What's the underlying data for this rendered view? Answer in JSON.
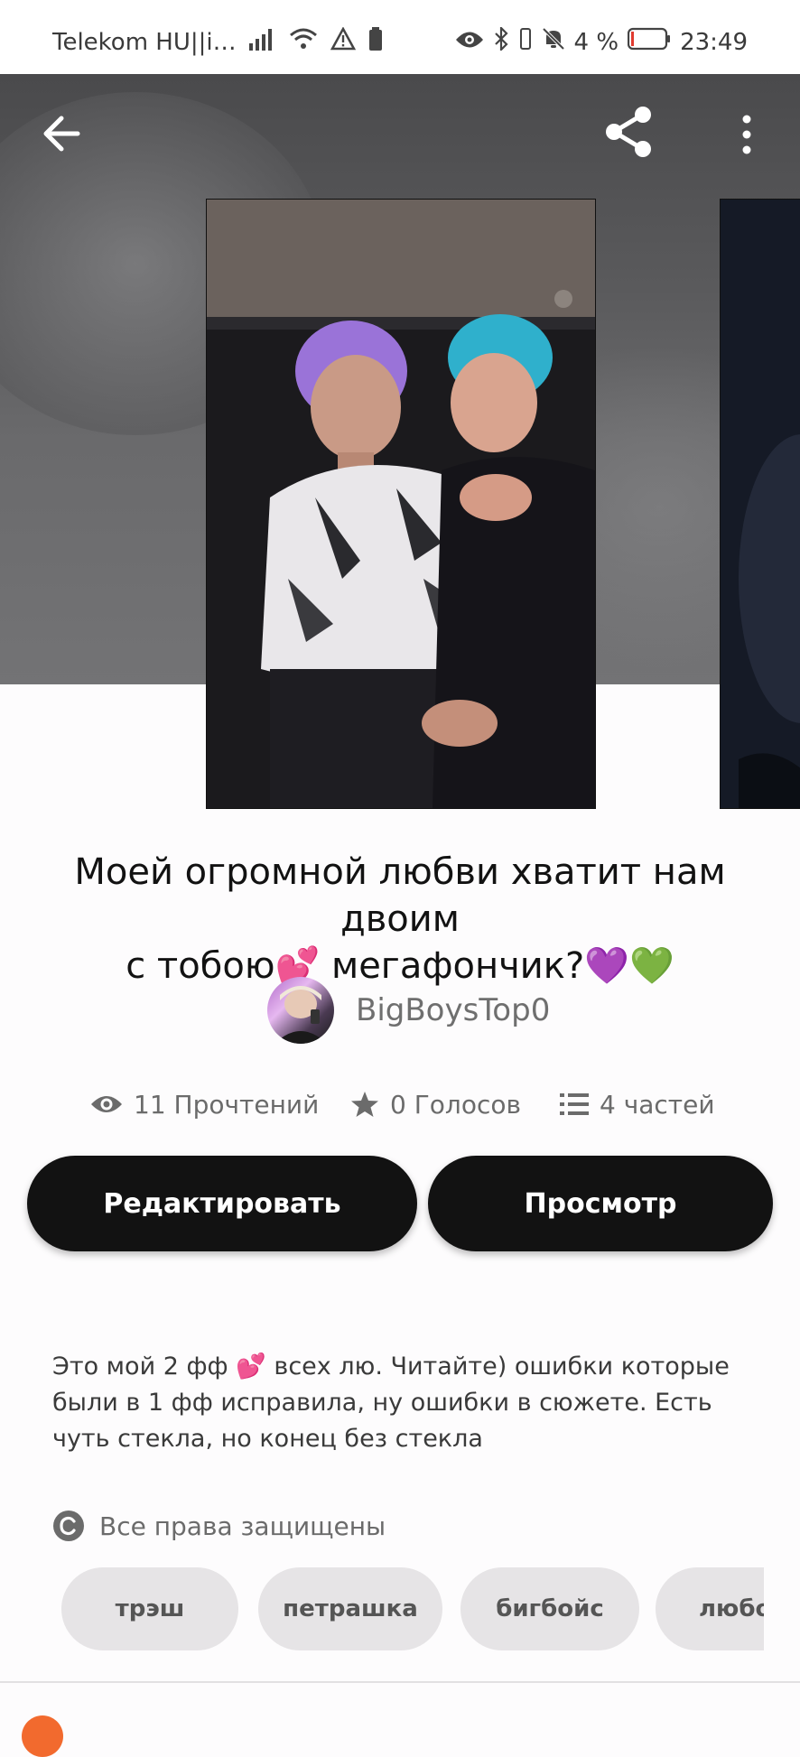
{
  "status_bar": {
    "carrier": "Telekom HU||i…",
    "battery_percent": "4 %",
    "time": "23:49"
  },
  "header": {
    "back_icon": "arrow-left-icon",
    "share_icon": "share-icon",
    "more_icon": "more-vertical-icon"
  },
  "story": {
    "title_line1": "Моей огромной любви хватит нам двоим",
    "title_line2": "с тобою💕     мегафончик?💜💚",
    "author": "BigBoysTop0",
    "stats": {
      "reads": "11 Прочтений",
      "votes": "0 Голосов",
      "parts": "4 частей"
    },
    "description": "Это мой 2 фф 💕 всех лю. Читайте) ошибки которые были в 1 фф исправила, ну ошибки в сюжете. Есть чуть стекла, но конец без стекла",
    "copyright": "Все права защищены",
    "tags": [
      "трэш",
      "петрашка",
      "бигбойс",
      "любо"
    ]
  },
  "actions": {
    "edit_label": "Редактировать",
    "view_label": "Просмотр"
  },
  "colors": {
    "button_bg": "#121212",
    "tag_bg": "#e6e4e6",
    "accent_orange": "#f26a2e"
  }
}
